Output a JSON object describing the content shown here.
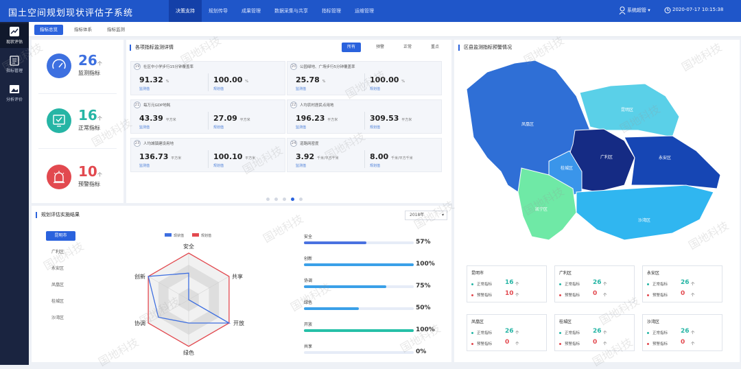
{
  "header": {
    "title": "国土空间规划现状评估子系统",
    "nav": [
      "决策支持",
      "规划传导",
      "成果管理",
      "数据采集与共享",
      "指标管理",
      "运维管理"
    ],
    "active_nav": "决策支持",
    "user": "系统超管 ▾",
    "datetime": "2020-07-17  10:15:38"
  },
  "sidebar": {
    "items": [
      {
        "label": "现状评估",
        "icon": "chart-icon"
      },
      {
        "label": "指标管理",
        "icon": "clipboard-icon"
      },
      {
        "label": "分析评价",
        "icon": "image-icon"
      }
    ]
  },
  "tabs": [
    "指标总览",
    "指标体系",
    "指标监测"
  ],
  "kpis": [
    {
      "num": "26",
      "unit": "个",
      "label": "监测指标",
      "color": "#3d70e0"
    },
    {
      "num": "16",
      "unit": "个",
      "label": "正常指标",
      "color": "#26b5a5"
    },
    {
      "num": "10",
      "unit": "个",
      "label": "预警指标",
      "color": "#e2494f"
    }
  ],
  "monitor": {
    "title": "各项指标监测详情",
    "filters": [
      "所有",
      "预警",
      "正常",
      "重点"
    ],
    "cards": [
      {
        "no": "19",
        "title": "社区中小学步行15分钟覆盖率",
        "v1": "91.32",
        "u1": "%",
        "l1": "监测值",
        "v2": "100.00",
        "u2": "%",
        "l2": "规划值"
      },
      {
        "no": "20",
        "title": "公园绿地、广场步行5分钟覆盖率",
        "v1": "25.78",
        "u1": "%",
        "l1": "监测值",
        "v2": "100.00",
        "u2": "%",
        "l2": "规划值"
      },
      {
        "no": "21",
        "title": "每万元GDP地耗",
        "v1": "43.39",
        "u1": "平方米",
        "l1": "监测值",
        "v2": "27.09",
        "u2": "平方米",
        "l2": "规划值"
      },
      {
        "no": "22",
        "title": "人均农村居民点用地",
        "v1": "196.23",
        "u1": "平方米",
        "l1": "监测值",
        "v2": "309.53",
        "u2": "平方米",
        "l2": "规划值"
      },
      {
        "no": "23",
        "title": "人均城镇建设用地",
        "v1": "136.73",
        "u1": "平方米",
        "l1": "监测值",
        "v2": "100.10",
        "u2": "平方米",
        "l2": "规划值"
      },
      {
        "no": "24",
        "title": "道路网密度",
        "v1": "3.92",
        "u1": "千米/平方千米",
        "l1": "监测值",
        "v2": "8.00",
        "u2": "千米/平方千米",
        "l2": "规划值"
      }
    ]
  },
  "evaluation": {
    "title": "规划评估实施结果",
    "year": "2018年",
    "districts": [
      "昆明市",
      "广利区",
      "永安区",
      "凤凰区",
      "桂城区",
      "沙湾区"
    ],
    "legend": [
      "现状值",
      "规划值"
    ],
    "bars": [
      {
        "label": "安全",
        "pct": "57%",
        "value": 57,
        "color": "#4a72e0"
      },
      {
        "label": "创新",
        "pct": "100%",
        "value": 100,
        "color": "#3aa0e8"
      },
      {
        "label": "协调",
        "pct": "75%",
        "value": 75,
        "color": "#3aa0e8"
      },
      {
        "label": "绿色",
        "pct": "50%",
        "value": 50,
        "color": "#3aa0e8"
      },
      {
        "label": "开放",
        "pct": "100%",
        "value": 100,
        "color": "#26c0a8"
      },
      {
        "label": "共享",
        "pct": "0%",
        "value": 0,
        "color": "#26c0a8"
      }
    ]
  },
  "chart_data": {
    "type": "radar",
    "axes": [
      "安全",
      "共享",
      "开放",
      "绿色",
      "协调",
      "创新"
    ],
    "series": [
      {
        "name": "现状值",
        "values": [
          57,
          0,
          100,
          50,
          75,
          100
        ]
      },
      {
        "name": "规划值",
        "values": [
          100,
          100,
          100,
          100,
          100,
          100
        ]
      }
    ]
  },
  "map": {
    "title": "区县监测指标预警情况",
    "regions": [
      "凤凰区",
      "昆明区",
      "广利区",
      "永安区",
      "桂城区",
      "沙湾区",
      "凯宁区"
    ]
  },
  "summary": [
    {
      "name": "昆明市",
      "normal_label": "正常指标",
      "normal": "16",
      "warn_label": "预警指标",
      "warn": "10",
      "unit": "个"
    },
    {
      "name": "广利区",
      "normal_label": "正常指标",
      "normal": "26",
      "warn_label": "预警指标",
      "warn": "0",
      "unit": "个"
    },
    {
      "name": "永安区",
      "normal_label": "正常指标",
      "normal": "26",
      "warn_label": "预警指标",
      "warn": "0",
      "unit": "个"
    },
    {
      "name": "凤凰区",
      "normal_label": "正常指标",
      "normal": "26",
      "warn_label": "预警指标",
      "warn": "0",
      "unit": "个"
    },
    {
      "name": "桂城区",
      "normal_label": "正常指标",
      "normal": "26",
      "warn_label": "预警指标",
      "warn": "0",
      "unit": "个"
    },
    {
      "name": "沙湾区",
      "normal_label": "正常指标",
      "normal": "26",
      "warn_label": "预警指标",
      "warn": "0",
      "unit": "个"
    }
  ],
  "watermark": "国地科技"
}
